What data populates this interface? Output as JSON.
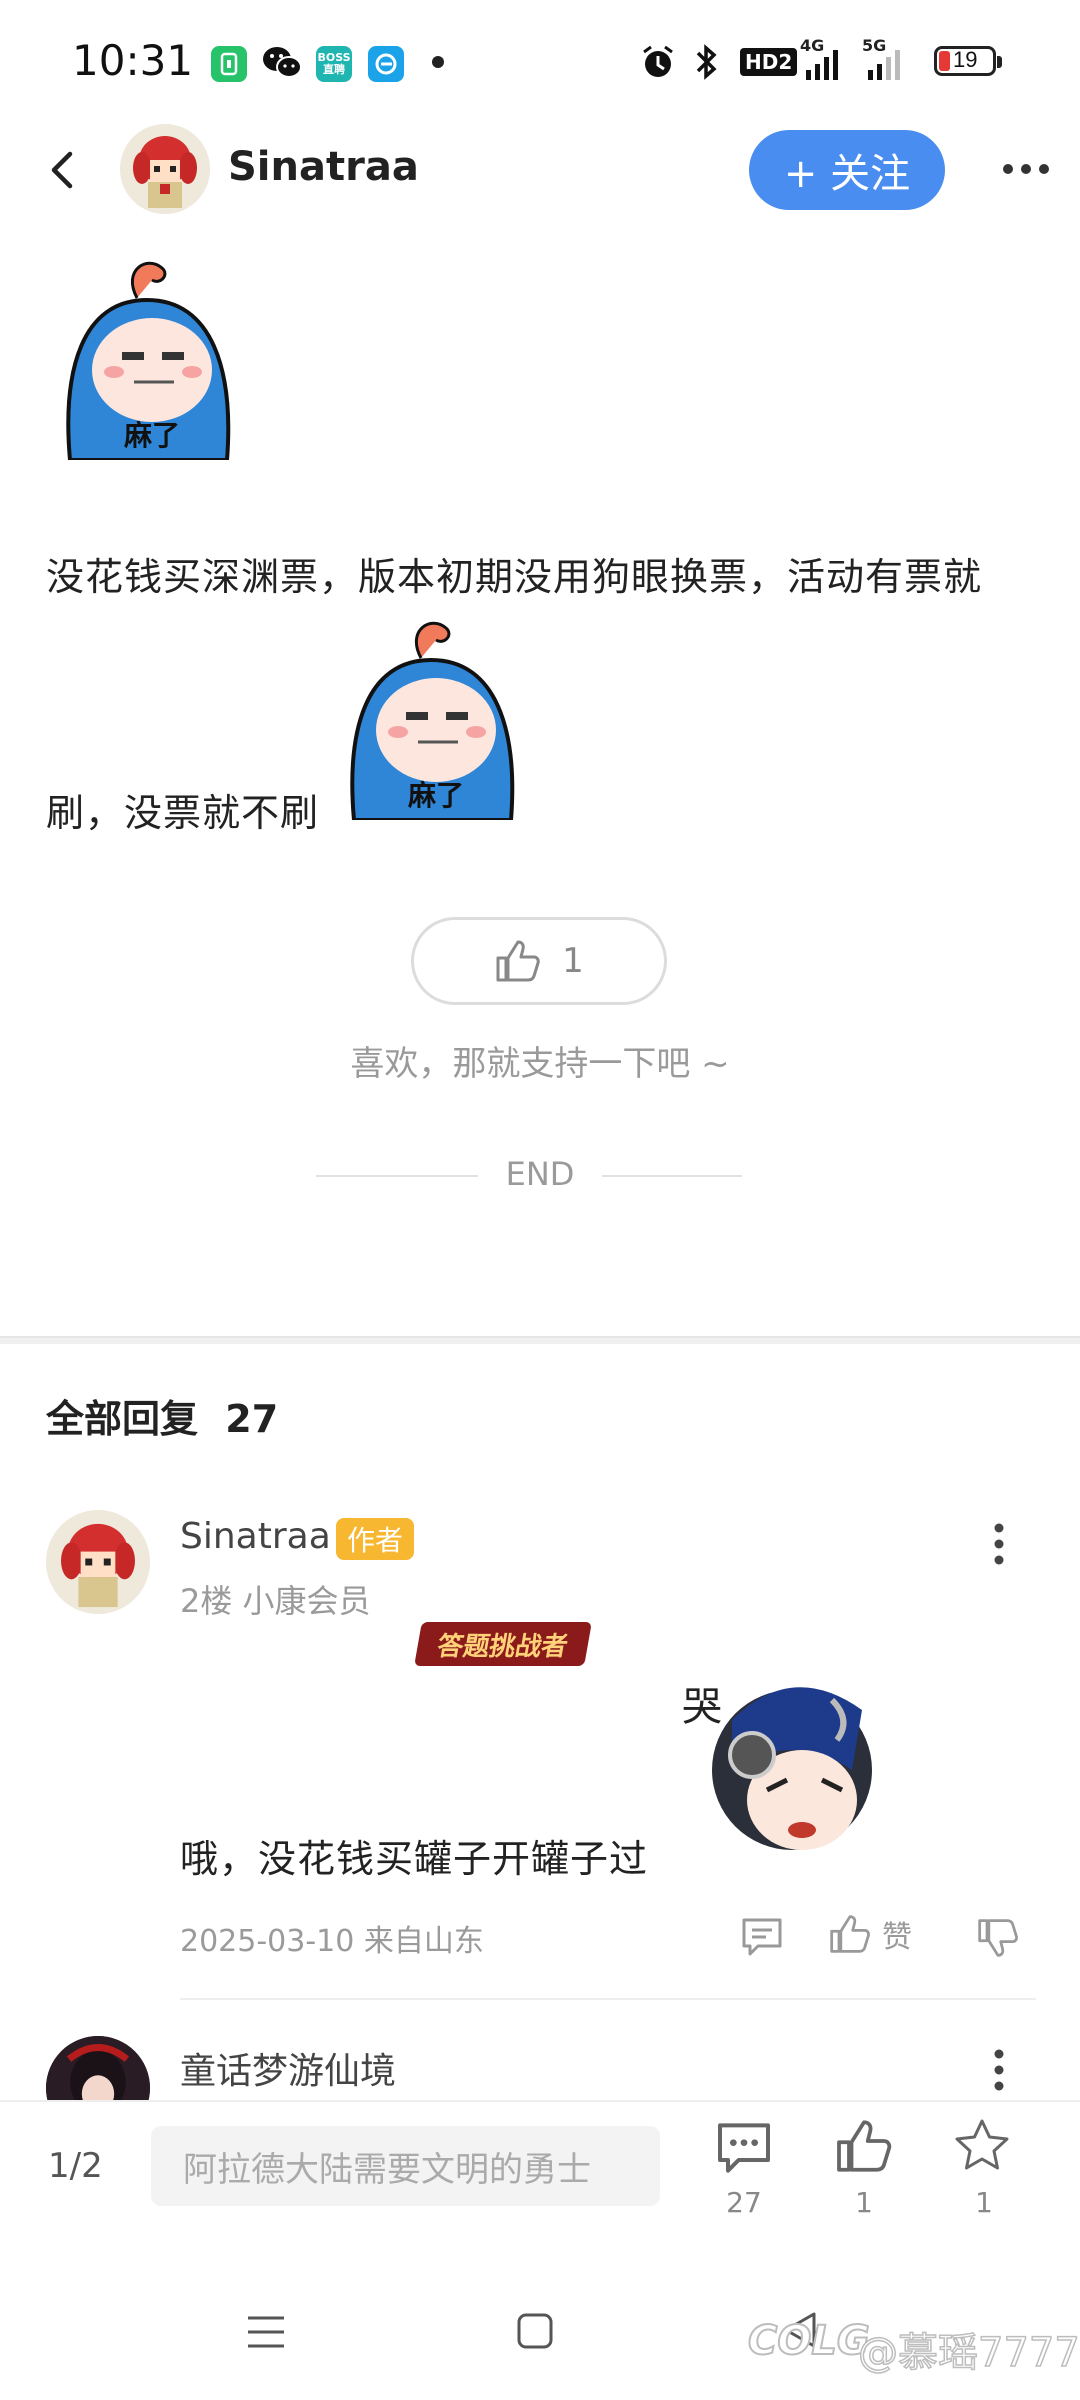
{
  "status_bar": {
    "time": "10:31",
    "app_icons": [
      "phone-manager-icon",
      "wechat-icon",
      "boss-zhipin-icon",
      "browser-icon"
    ],
    "right_icons": [
      "alarm-icon",
      "bluetooth-icon",
      "hd-icon",
      "signal-4g-icon",
      "signal-5g-icon"
    ],
    "hd_label": "HD2",
    "g4_label": "4G",
    "g5_label": "5G",
    "battery": "19",
    "boss_label": "BOSS\n直聘"
  },
  "header": {
    "back_icon": "back-chevron-icon",
    "username": "Sinatraa",
    "follow_label": "+ 关注",
    "more_icon": "more-horizontal-icon"
  },
  "post": {
    "sticker_text": "麻了",
    "line1": "没花钱买深渊票，版本初期没用狗眼换票，活动有票就",
    "line2": "刷，没票就不刷",
    "like_count": "1",
    "support_text": "喜欢，那就支持一下吧 ~",
    "end_text": "END"
  },
  "replies": {
    "header_label": "全部回复",
    "total": "27",
    "items": [
      {
        "name": "Sinatraa",
        "badge": "作者",
        "meta": "2楼 小康会员",
        "text": "哦，没花钱买罐子开罐子过",
        "sticker_text": "哭",
        "date": "2025-03-10 来自山东",
        "like_label": "赞"
      },
      {
        "name": "童话梦游仙境",
        "badge": "答题挑战者"
      }
    ]
  },
  "bottom_bar": {
    "page": "1/2",
    "input_placeholder": "阿拉德大陆需要文明的勇士",
    "comment_count": "27",
    "like_count": "1",
    "fav_count": "1"
  },
  "watermark": "@慕瑶7777",
  "watermark_logo": "COLG",
  "colors": {
    "accent": "#4a8df0",
    "author_badge": "#f7b731",
    "quiz_badge": "#8b1a1a"
  }
}
